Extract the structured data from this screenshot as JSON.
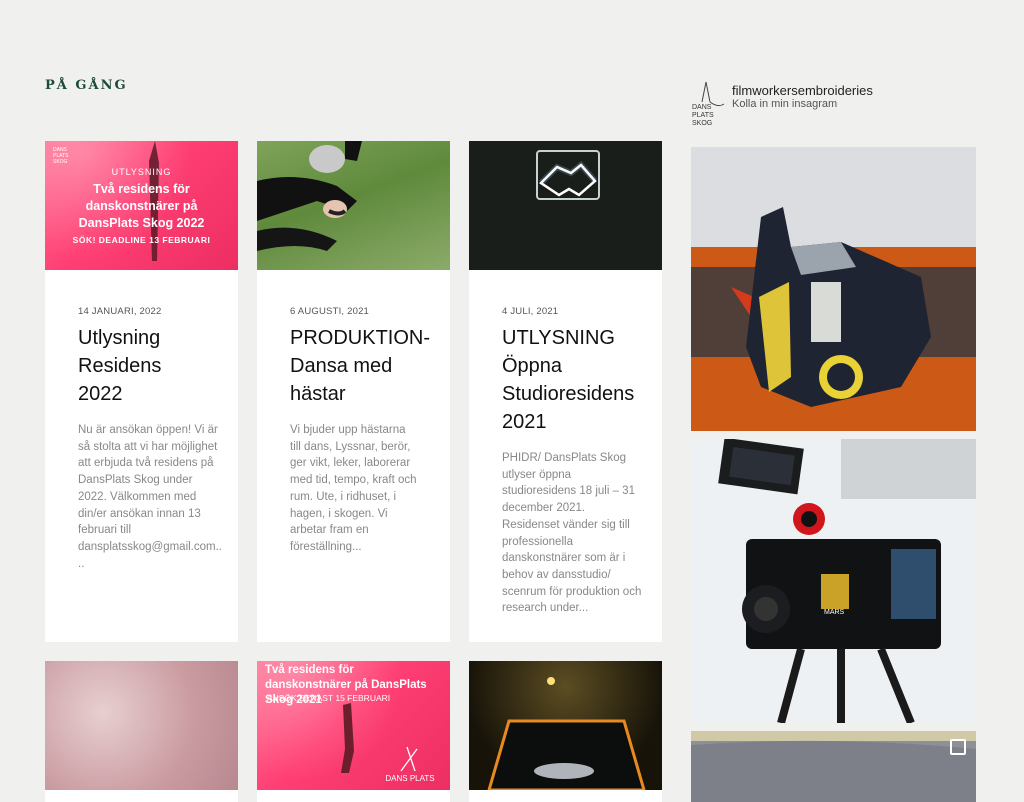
{
  "section": {
    "title": "PÅ GÅNG"
  },
  "posts": [
    {
      "date": "14 JANUARI, 2022",
      "title": "Utlysning Residens 2022",
      "excerpt": "Nu är ansökan öppen! Vi är så stolta att vi har möjlighet att erbjuda två residens på DansPlats Skog under 2022. Välkommen med din/er ansökan innan 13 februari till dansplatsskog@gmail.com....",
      "image": {
        "label": "UTLYSNING",
        "headline": "Två residens för danskonstnärer på DansPlats Skog 2022",
        "deadline": "SÖK! DEADLINE 13 FEBRUARI"
      }
    },
    {
      "date": "6 AUGUSTI, 2021",
      "title": "PRODUKTION- Dansa med hästar",
      "excerpt": "Vi bjuder upp hästarna till dans, Lyssnar, berör, ger vikt, leker, laborerar med tid, tempo, kraft och rum. Ute, i ridhuset, i hagen, i skogen. Vi arbetar fram en föreställning..."
    },
    {
      "date": "4 JULI, 2021",
      "title": "UTLYSNING Öppna Studioresidens 2021",
      "excerpt": "PHIDR/ DansPlats Skog utlyser öppna studioresidens 18 juli – 31 december 2021. Residenset vänder sig till professionella danskonstnärer som är i behov av dansstudio/ scenrum för produktion och research under..."
    }
  ],
  "row2": {
    "card2_headline": "Två residens för danskonstnärer på DansPlats Skog 2021",
    "card2_sub": "ANSÖK SENAST 15 FEBRUARI",
    "card2_logo": "DANS PLATS"
  },
  "logo_text": {
    "line1": "DANS",
    "line2": "PLATS",
    "line3": "SKOG"
  },
  "instagram": {
    "username": "filmworkersembroideries",
    "subtitle": "Kolla in min insagram",
    "camera_badge": "MARS"
  },
  "colors": {
    "accent": "#1e4a3a",
    "pink": "#ff3f74",
    "background": "#f0f1ef"
  }
}
